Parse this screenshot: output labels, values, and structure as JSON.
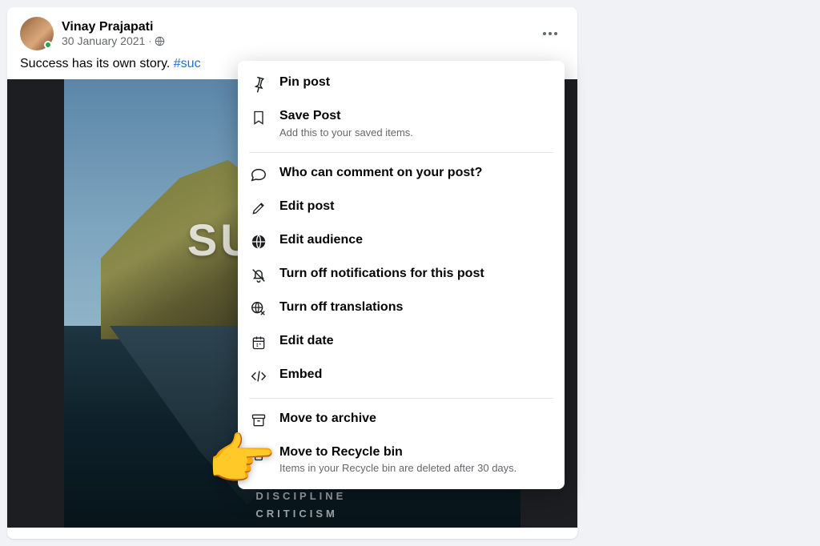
{
  "post": {
    "author": "Vinay Prajapati",
    "date": "30 January 2021",
    "body_text": "Success has its own story. ",
    "hashtag": "#suc",
    "image_overlay_text": "SU",
    "image_bottom_line1": "DISCIPLINE",
    "image_bottom_line2": "CRITICISM"
  },
  "menu": {
    "pin": "Pin post",
    "save": "Save Post",
    "save_sub": "Add this to your saved items.",
    "who_comment": "Who can comment on your post?",
    "edit_post": "Edit post",
    "edit_audience": "Edit audience",
    "turn_off_notifs": "Turn off notifications for this post",
    "turn_off_trans": "Turn off translations",
    "edit_date": "Edit date",
    "embed": "Embed",
    "archive": "Move to archive",
    "recycle": "Move to Recycle bin",
    "recycle_sub": "Items in your Recycle bin are deleted after 30 days."
  },
  "pointer_emoji": "👉"
}
